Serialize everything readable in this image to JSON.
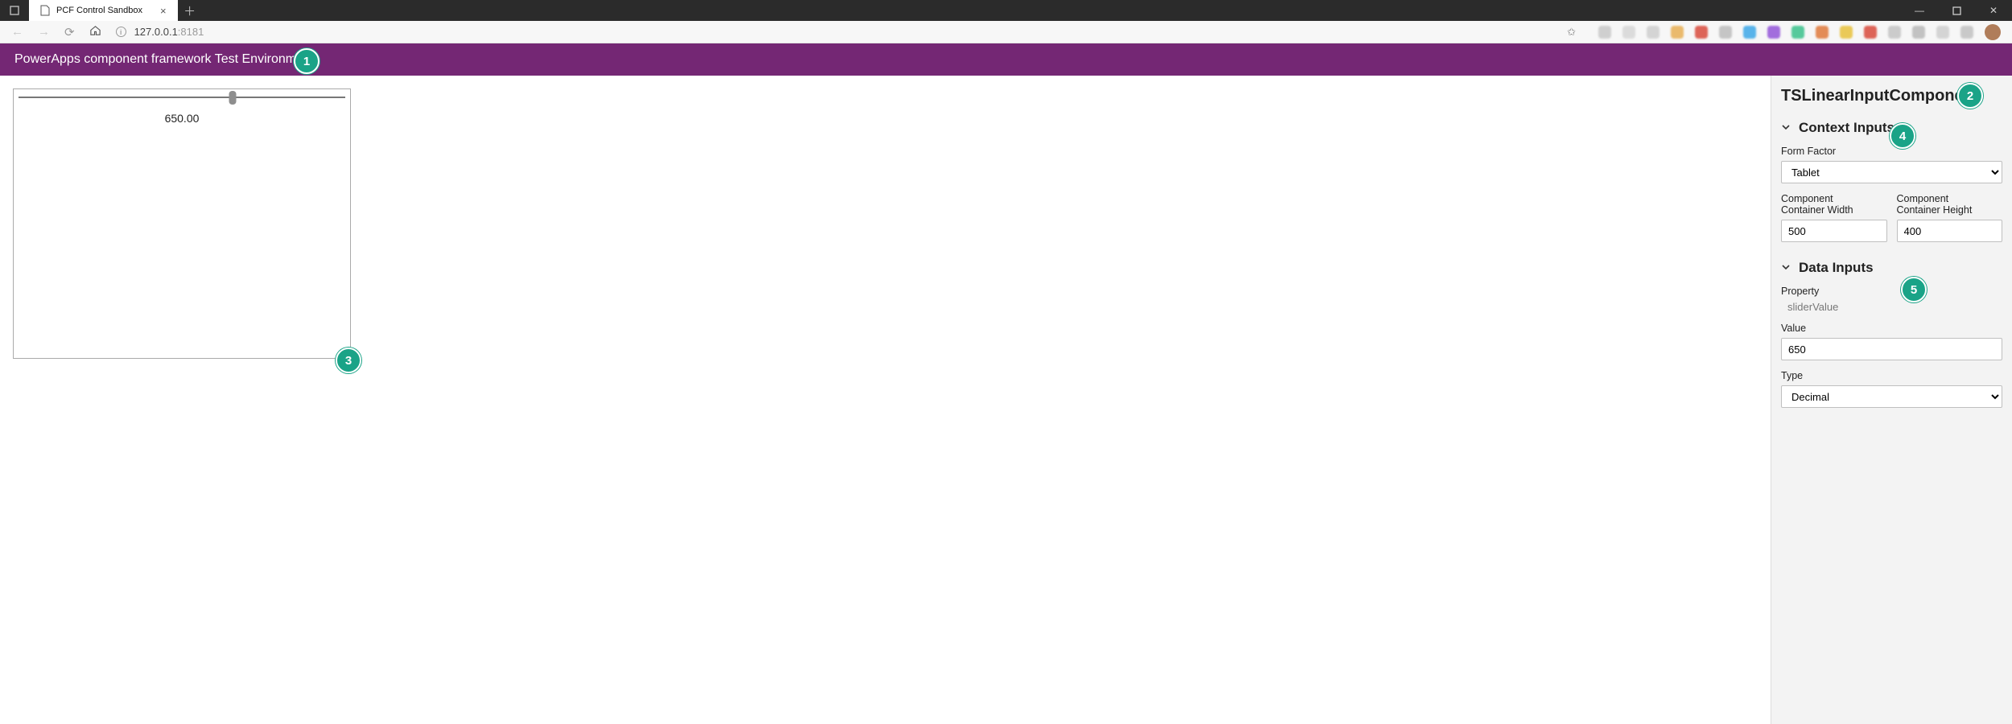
{
  "browser": {
    "tab_title": "PCF Control Sandbox",
    "url_host": "127.0.0.1",
    "url_port": ":8181"
  },
  "header": {
    "title": "PowerApps component framework Test Environment"
  },
  "control": {
    "display_value": "650.00"
  },
  "sidebar": {
    "component_name": "TSLinearInputComponent",
    "context_section": "Context Inputs",
    "form_factor_label": "Form Factor",
    "form_factor_value": "Tablet",
    "width_label_line1": "Component",
    "width_label_line2": "Container Width",
    "width_value": "500",
    "height_label_line1": "Component",
    "height_label_line2": "Container Height",
    "height_value": "400",
    "data_section": "Data Inputs",
    "property_label": "Property",
    "property_value": "sliderValue",
    "value_label": "Value",
    "value_value": "650",
    "type_label": "Type",
    "type_value": "Decimal"
  },
  "badges": {
    "b1": "1",
    "b2": "2",
    "b3": "3",
    "b4": "4",
    "b5": "5"
  }
}
